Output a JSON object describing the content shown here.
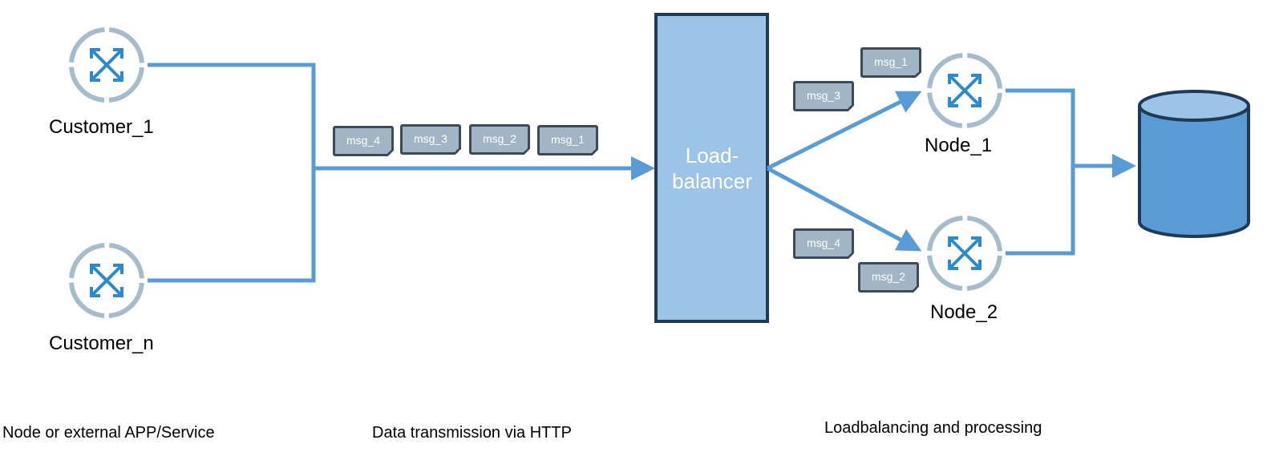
{
  "nodes": {
    "customer_1": {
      "label": "Customer_1"
    },
    "customer_n": {
      "label": "Customer_n"
    },
    "node_1": {
      "label": "Node_1"
    },
    "node_2": {
      "label": "Node_2"
    },
    "loadbalancer": {
      "label_line1": "Load-",
      "label_line2": "balancer"
    },
    "database": {
      "label": ""
    }
  },
  "messages": {
    "http_queue": [
      "msg_4",
      "msg_3",
      "msg_2",
      "msg_1"
    ],
    "to_node_1": [
      "msg_1",
      "msg_3"
    ],
    "to_node_2": [
      "msg_4",
      "msg_2"
    ]
  },
  "captions": {
    "section_1": "Node or external APP/Service",
    "section_2": "Data transmission via HTTP",
    "section_3": "Loadbalancing and processing"
  },
  "colors": {
    "connector": "#5b9bd5",
    "loadbalancer_fill": "#9dc3e6",
    "loadbalancer_border": "#1f3a56",
    "database_fill": "#5b9bd5",
    "database_top": "#9dc3e6",
    "message_fill": "#a1b5c4",
    "message_border": "#3c4a55",
    "node_ring": "#a7bccb",
    "node_icon": "#2e8bc9"
  }
}
